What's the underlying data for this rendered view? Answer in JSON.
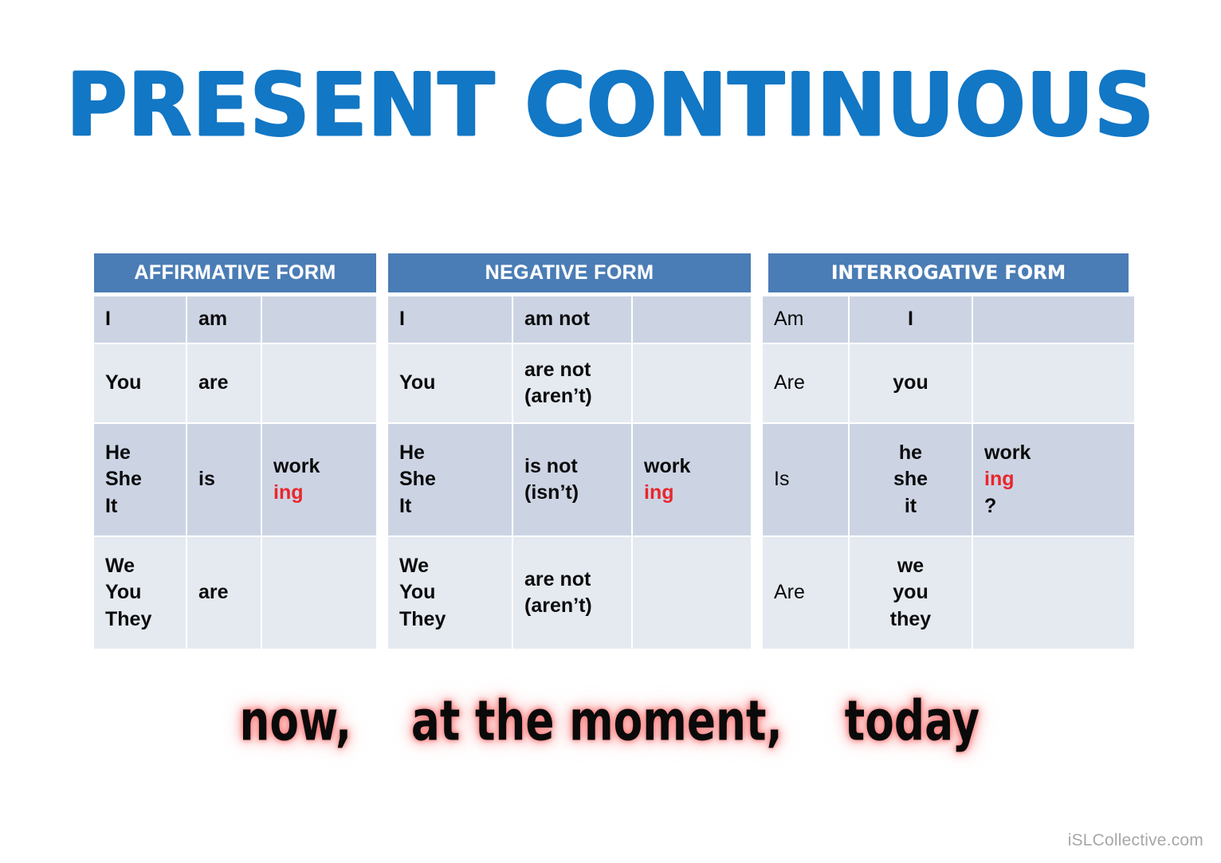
{
  "title": "PRESENT CONTINUOUS",
  "colors": {
    "title_blue": "#1277c5",
    "header_blue": "#4a7cb5",
    "row_dark": "#ccd4e4",
    "row_light": "#e5eaf1",
    "verb_suffix_red": "#e8272c",
    "glow_pink": "#f87878",
    "text_black": "#0b0b0b",
    "watermark_grey": "#a7a7a7"
  },
  "tables": {
    "affirmative": {
      "header": "AFFIRMATIVE FORM",
      "rows": [
        {
          "subject": [
            "I"
          ],
          "aux": "am",
          "verb_stem": "",
          "verb_suffix": "",
          "verb_tail": ""
        },
        {
          "subject": [
            "You"
          ],
          "aux": "are",
          "verb_stem": "",
          "verb_suffix": "",
          "verb_tail": ""
        },
        {
          "subject": [
            "He",
            "She",
            "It"
          ],
          "aux": "is",
          "verb_stem": "work",
          "verb_suffix": "ing",
          "verb_tail": ""
        },
        {
          "subject": [
            "We",
            "You",
            "They"
          ],
          "aux": "are",
          "verb_stem": "",
          "verb_suffix": "",
          "verb_tail": ""
        }
      ]
    },
    "negative": {
      "header": "NEGATIVE FORM",
      "rows": [
        {
          "subject": [
            "I"
          ],
          "aux": [
            "am not"
          ],
          "verb_stem": "",
          "verb_suffix": "",
          "verb_tail": ""
        },
        {
          "subject": [
            "You"
          ],
          "aux": [
            "are not",
            "(aren’t)"
          ],
          "verb_stem": "",
          "verb_suffix": "",
          "verb_tail": ""
        },
        {
          "subject": [
            "He",
            "She",
            "It"
          ],
          "aux": [
            "is not",
            "(isn’t)"
          ],
          "verb_stem": "work",
          "verb_suffix": "ing",
          "verb_tail": ""
        },
        {
          "subject": [
            "We",
            "You",
            "They"
          ],
          "aux": [
            "are not",
            "(aren’t)"
          ],
          "verb_stem": "",
          "verb_suffix": "",
          "verb_tail": ""
        }
      ]
    },
    "interrogative": {
      "header": "INTERROGATIVE FORM",
      "rows": [
        {
          "aux": "Am",
          "subject": [
            "I"
          ],
          "verb_stem": "",
          "verb_suffix": "",
          "verb_tail": ""
        },
        {
          "aux": "Are",
          "subject": [
            "you"
          ],
          "verb_stem": "",
          "verb_suffix": "",
          "verb_tail": ""
        },
        {
          "aux": "Is",
          "subject": [
            "he",
            "she",
            "it"
          ],
          "verb_stem": "work",
          "verb_suffix": "ing",
          "verb_tail": "?"
        },
        {
          "aux": "Are",
          "subject": [
            "we",
            "you",
            "they"
          ],
          "verb_stem": "",
          "verb_suffix": "",
          "verb_tail": ""
        }
      ]
    }
  },
  "time_expressions": [
    "now,",
    "at the moment,",
    "today"
  ],
  "watermark": "iSLCollective.com"
}
